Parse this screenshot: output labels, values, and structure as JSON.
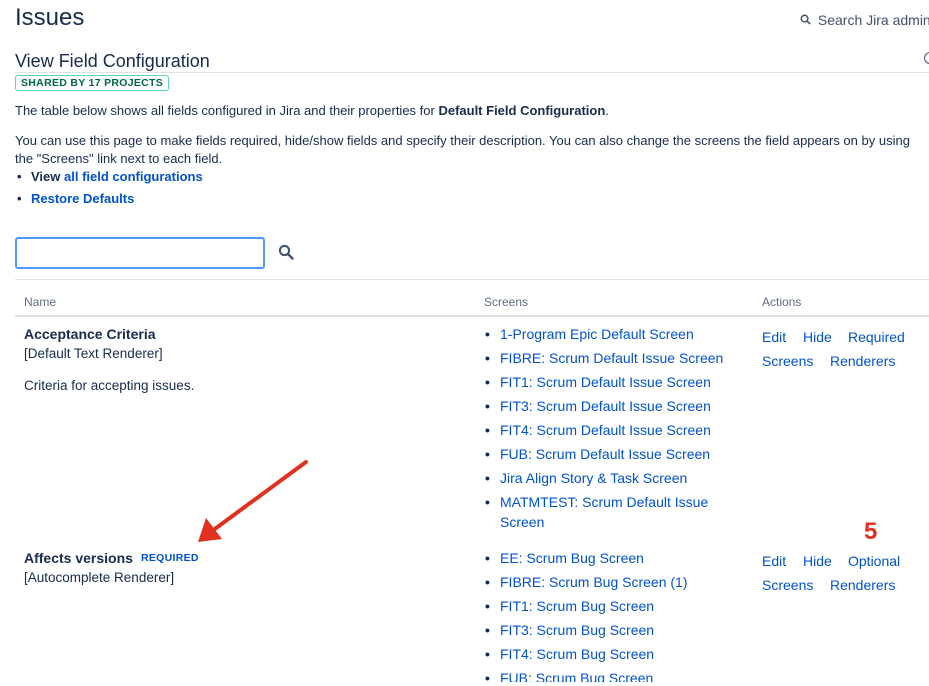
{
  "header": {
    "title": "Issues",
    "search_label": "Search Jira admin"
  },
  "page": {
    "title": "View Field Configuration",
    "shared_badge": "SHARED BY 17 PROJECTS",
    "intro_prefix": "The table below shows all fields configured in Jira and their properties for ",
    "intro_bold": "Default Field Configuration",
    "intro_suffix": ".",
    "description": "You can use this page to make fields required, hide/show fields and specify their description. You can also change the screens the field appears on by using the \"Screens\" link next to each field.",
    "view_prefix": "View ",
    "view_link": "all field configurations",
    "restore_link": "Restore Defaults"
  },
  "filter": {
    "value": "",
    "placeholder": ""
  },
  "table": {
    "columns": {
      "name": "Name",
      "screens": "Screens",
      "actions": "Actions"
    },
    "rows": [
      {
        "name": "Acceptance Criteria",
        "renderer": "[Default Text Renderer]",
        "description": "Criteria for accepting issues.",
        "required_badge": "",
        "screens": [
          "1-Program Epic Default Screen",
          "FIBRE: Scrum Default Issue Screen",
          "FIT1: Scrum Default Issue Screen",
          "FIT3: Scrum Default Issue Screen",
          "FIT4: Scrum Default Issue Screen",
          "FUB: Scrum Default Issue Screen",
          "Jira Align Story & Task Screen",
          "MATMTEST: Scrum Default Issue Screen"
        ],
        "actions": {
          "edit": "Edit",
          "hide": "Hide",
          "toggle": "Required",
          "screens": "Screens",
          "renderers": "Renderers"
        }
      },
      {
        "name": "Affects versions",
        "renderer": "[Autocomplete Renderer]",
        "description": "",
        "required_badge": "REQUIRED",
        "screens": [
          "EE: Scrum Bug Screen",
          "FIBRE: Scrum Bug Screen (1)",
          "FIT1: Scrum Bug Screen",
          "FIT3: Scrum Bug Screen",
          "FIT4: Scrum Bug Screen",
          "FUB: Scrum Bug Screen"
        ],
        "actions": {
          "edit": "Edit",
          "hide": "Hide",
          "toggle": "Optional",
          "screens": "Screens",
          "renderers": "Renderers"
        }
      }
    ]
  },
  "annotation": {
    "number": "5",
    "color": "#e0301e"
  },
  "colors": {
    "link": "#0052cc",
    "text": "#172b4d",
    "badge_green": "#006644",
    "focus_border": "#4c9aff"
  },
  "icons": {
    "search": "search-icon",
    "help": "help-icon",
    "arrow": "annotation-arrow"
  }
}
